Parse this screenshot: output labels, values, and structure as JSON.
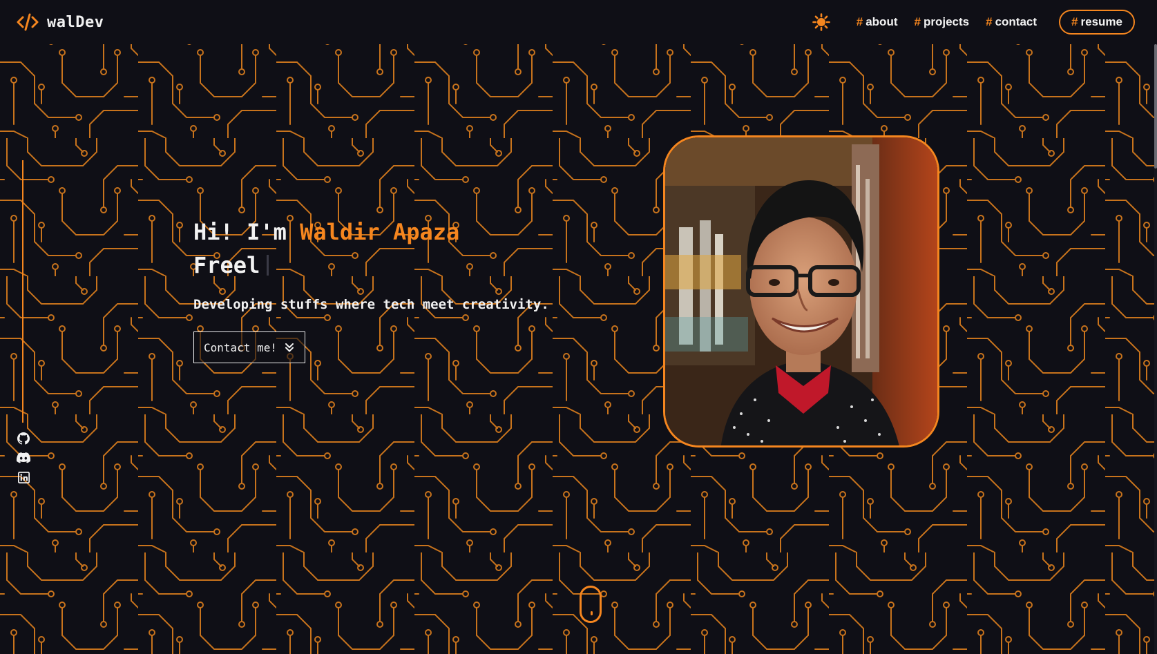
{
  "brand": {
    "name": "walDev",
    "icon": "code-icon"
  },
  "nav": {
    "theme_icon": "sun-icon",
    "items": [
      {
        "hash": "#",
        "label": "about"
      },
      {
        "hash": "#",
        "label": "projects"
      },
      {
        "hash": "#",
        "label": "contact"
      }
    ],
    "resume": {
      "hash": "#",
      "label": "resume"
    }
  },
  "hero": {
    "greeting": "Hi! I'm ",
    "name": "Waldir Apaza",
    "typed": "Freel",
    "tagline": "Developing stuffs where tech meet creativity.",
    "cta": "Contact me!"
  },
  "socials": [
    "github-icon",
    "discord-icon",
    "linkedin-icon"
  ],
  "colors": {
    "accent": "#f5861f",
    "background": "#0f0f16",
    "text": "#f2f2f2"
  }
}
